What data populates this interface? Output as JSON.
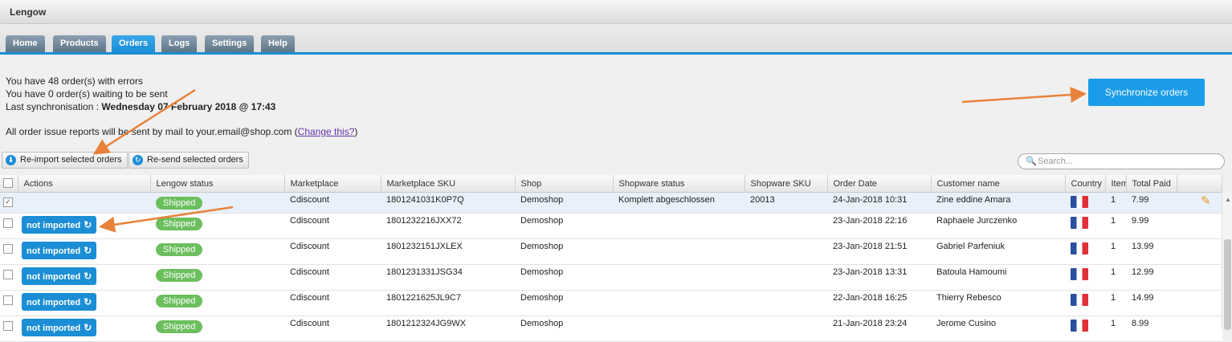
{
  "app": {
    "title": "Lengow"
  },
  "tabs": [
    {
      "label": "Home",
      "active": false
    },
    {
      "label": "Products",
      "active": false
    },
    {
      "label": "Orders",
      "active": true
    },
    {
      "label": "Logs",
      "active": false
    },
    {
      "label": "Settings",
      "active": false
    },
    {
      "label": "Help",
      "active": false
    }
  ],
  "info": {
    "errors_line": "You have 48 order(s) with errors",
    "waiting_line": "You have 0 order(s) waiting to be sent",
    "sync_prefix": "Last synchronisation : ",
    "sync_date": "Wednesday 07 February 2018 @ 17:43",
    "mail_text": "All order issue reports will be sent by mail to your.email@shop.com ",
    "change_link_open": "(",
    "change_link": "Change this?",
    "change_link_close": ")"
  },
  "toolbar": {
    "sync_button": "Synchronize orders",
    "reimport_button": "Re-import selected orders",
    "resend_button": "Re-send selected orders",
    "search_placeholder": "Search..."
  },
  "table": {
    "columns": [
      "Actions",
      "Lengow status",
      "Marketplace",
      "Marketplace SKU",
      "Shop",
      "Shopware status",
      "Shopware SKU",
      "Order Date",
      "Customer name",
      "Country",
      "Items",
      "Total Paid"
    ],
    "rows": [
      {
        "checked": true,
        "action": "",
        "lengow_status": "Shipped",
        "marketplace": "Cdiscount",
        "marketplace_sku": "1801241031K0P7Q",
        "shop": "Demoshop",
        "shopware_status": "Komplett abgeschlossen",
        "shopware_sku": "20013",
        "order_date": "24-Jan-2018 10:31",
        "customer": "Zine eddine Amara",
        "country": "France",
        "items": "1",
        "total": "7.99"
      },
      {
        "checked": false,
        "action": "not imported",
        "lengow_status": "Shipped",
        "marketplace": "Cdiscount",
        "marketplace_sku": "1801232216JXX72",
        "shop": "Demoshop",
        "shopware_status": "",
        "shopware_sku": "",
        "order_date": "23-Jan-2018 22:16",
        "customer": "Raphaele Jurczenko",
        "country": "France",
        "items": "1",
        "total": "9.99"
      },
      {
        "checked": false,
        "action": "not imported",
        "lengow_status": "Shipped",
        "marketplace": "Cdiscount",
        "marketplace_sku": "1801232151JXLEX",
        "shop": "Demoshop",
        "shopware_status": "",
        "shopware_sku": "",
        "order_date": "23-Jan-2018 21:51",
        "customer": "Gabriel Parfeniuk",
        "country": "France",
        "items": "1",
        "total": "13.99"
      },
      {
        "checked": false,
        "action": "not imported",
        "lengow_status": "Shipped",
        "marketplace": "Cdiscount",
        "marketplace_sku": "1801231331JSG34",
        "shop": "Demoshop",
        "shopware_status": "",
        "shopware_sku": "",
        "order_date": "23-Jan-2018 13:31",
        "customer": "Batoula Hamoumi",
        "country": "France",
        "items": "1",
        "total": "12.99"
      },
      {
        "checked": false,
        "action": "not imported",
        "lengow_status": "Shipped",
        "marketplace": "Cdiscount",
        "marketplace_sku": "1801221625JL9C7",
        "shop": "Demoshop",
        "shopware_status": "",
        "shopware_sku": "",
        "order_date": "22-Jan-2018 16:25",
        "customer": "Thierry Rebesco",
        "country": "France",
        "items": "1",
        "total": "14.99"
      },
      {
        "checked": false,
        "action": "not imported",
        "lengow_status": "Shipped",
        "marketplace": "Cdiscount",
        "marketplace_sku": "1801212324JG9WX",
        "shop": "Demoshop",
        "shopware_status": "",
        "shopware_sku": "",
        "order_date": "21-Jan-2018 23:24",
        "customer": "Jerome Cusino",
        "country": "France",
        "items": "1",
        "total": "8.99"
      }
    ]
  },
  "colors": {
    "accent": "#1b8ed6",
    "shipped": "#6cbf5e",
    "annotation_arrow": "#e8823a"
  }
}
